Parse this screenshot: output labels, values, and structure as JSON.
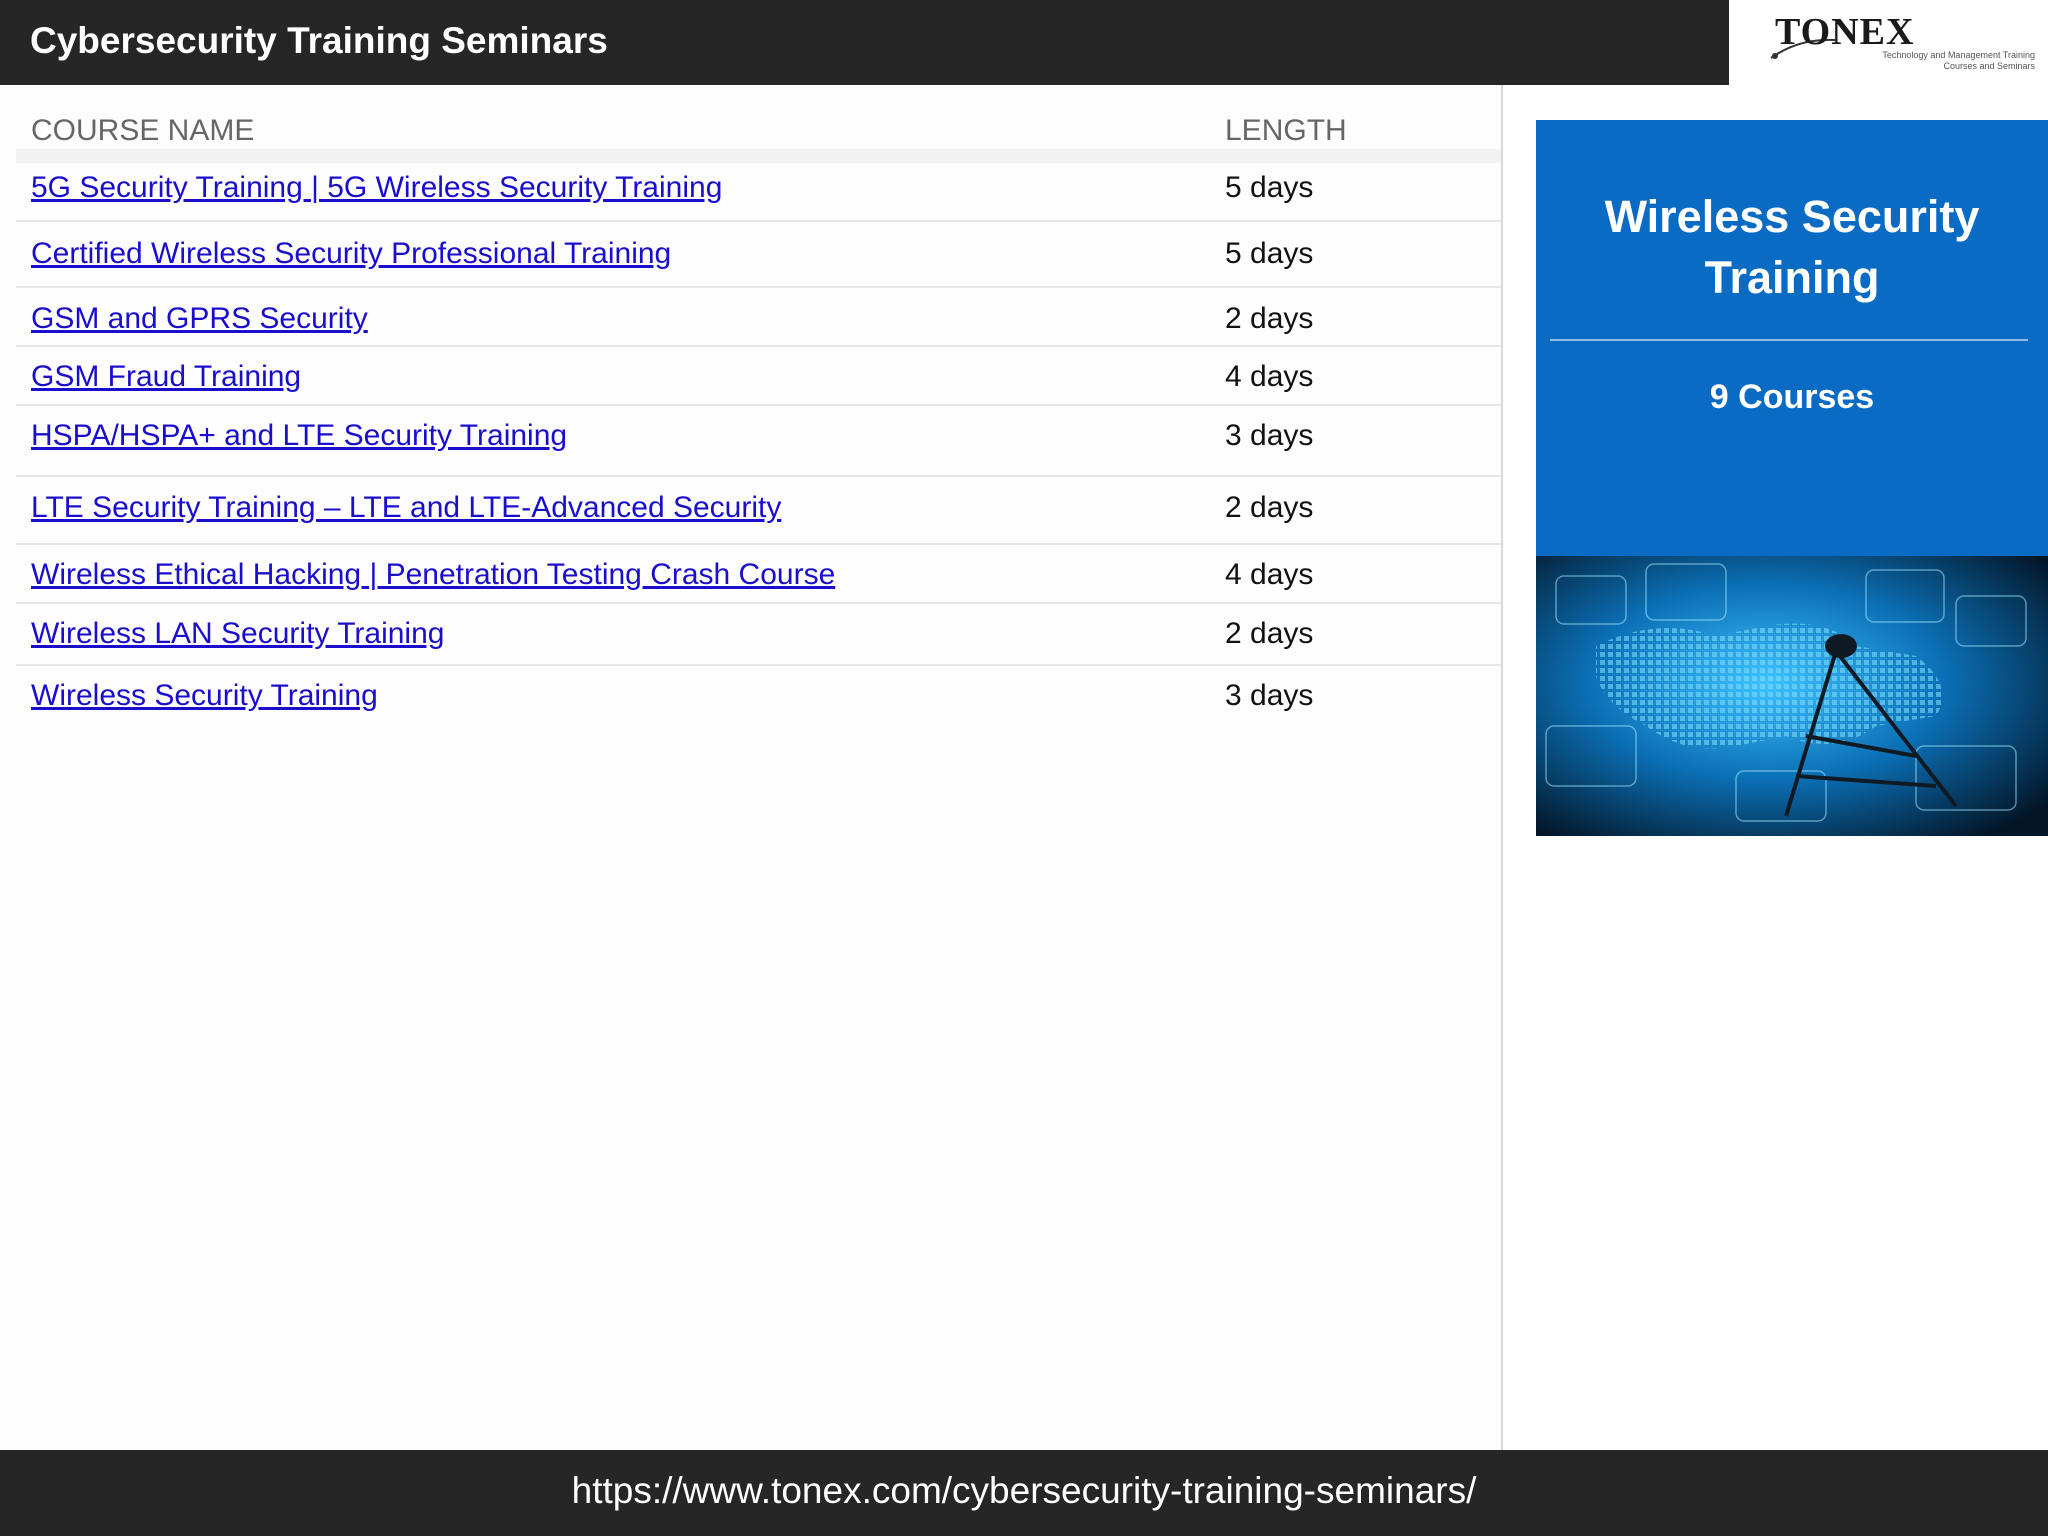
{
  "header": {
    "title": "Cybersecurity Training Seminars"
  },
  "logo": {
    "wordmark": "TONEX",
    "tagline": "Technology and Management Training Courses and Seminars"
  },
  "table": {
    "columns": {
      "name": "COURSE NAME",
      "length": "LENGTH"
    },
    "rows": [
      {
        "name": "5G Security Training | 5G Wireless Security Training",
        "length": "5 days"
      },
      {
        "name": "Certified Wireless Security Professional Training",
        "length": "5 days"
      },
      {
        "name": "GSM and GPRS Security",
        "length": "2 days"
      },
      {
        "name": "GSM Fraud Training",
        "length": "4 days"
      },
      {
        "name": "HSPA/HSPA+ and LTE Security Training",
        "length": "3 days"
      },
      {
        "name": "LTE Security Training – LTE and LTE-Advanced Security",
        "length": "2 days"
      },
      {
        "name": "Wireless Ethical Hacking | Penetration Testing Crash Course",
        "length": "4 days"
      },
      {
        "name": "Wireless LAN Security Training",
        "length": "2 days"
      },
      {
        "name": "Wireless Security Training",
        "length": "3 days"
      }
    ]
  },
  "promo": {
    "title_line1": "Wireless Security",
    "title_line2": "Training",
    "count": "9 Courses",
    "image": "world-map-network-satellite-image"
  },
  "footer": {
    "url": "https://www.tonex.com/cybersecurity-training-seminars/"
  },
  "colors": {
    "bar": "#262626",
    "link": "#1a0dcc",
    "promo_blue": "#0a6bc4"
  }
}
